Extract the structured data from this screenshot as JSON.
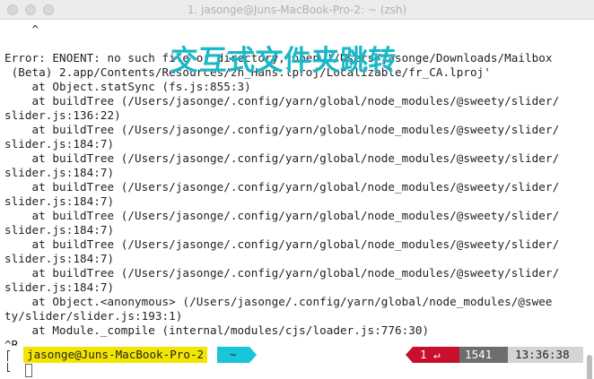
{
  "window": {
    "title": "1. jasonge@Juns-MacBook-Pro-2: ~ (zsh)"
  },
  "terminal": {
    "lines": [
      "    ^",
      "",
      "Error: ENOENT: no such file or directory, open '/Users/jasonge/Downloads/Mailbox",
      " (Beta) 2.app/Contents/Resources/zh_Hans.lproj/Localizable/fr_CA.lproj'",
      "    at Object.statSync (fs.js:855:3)",
      "    at buildTree (/Users/jasonge/.config/yarn/global/node_modules/@sweety/slider/",
      "slider.js:136:22)",
      "    at buildTree (/Users/jasonge/.config/yarn/global/node_modules/@sweety/slider/",
      "slider.js:184:7)",
      "    at buildTree (/Users/jasonge/.config/yarn/global/node_modules/@sweety/slider/",
      "slider.js:184:7)",
      "    at buildTree (/Users/jasonge/.config/yarn/global/node_modules/@sweety/slider/",
      "slider.js:184:7)",
      "    at buildTree (/Users/jasonge/.config/yarn/global/node_modules/@sweety/slider/",
      "slider.js:184:7)",
      "    at buildTree (/Users/jasonge/.config/yarn/global/node_modules/@sweety/slider/",
      "slider.js:184:7)",
      "    at buildTree (/Users/jasonge/.config/yarn/global/node_modules/@sweety/slider/",
      "slider.js:184:7)",
      "    at Object.<anonymous> (/Users/jasonge/.config/yarn/global/node_modules/@swee",
      "ty/slider/slider.js:193:1)",
      "    at Module._compile (internal/modules/cjs/loader.js:776:30)",
      "^R"
    ]
  },
  "overlay": {
    "caption": "交互式文件夹跳转",
    "color": "#1ab8c8"
  },
  "prompt": {
    "user_host": "jasonge@Juns-MacBook-Pro-2",
    "directory": "~",
    "exit_status": "1 ↵",
    "history_number": "1541",
    "time": "13:36:38"
  },
  "colors": {
    "prompt_user_bg": "#f2e600",
    "prompt_dir_bg": "#19c5d8",
    "exit_status_bg": "#c8102e",
    "history_bg": "#6e6e6e",
    "time_bg": "#d4d4d4"
  }
}
